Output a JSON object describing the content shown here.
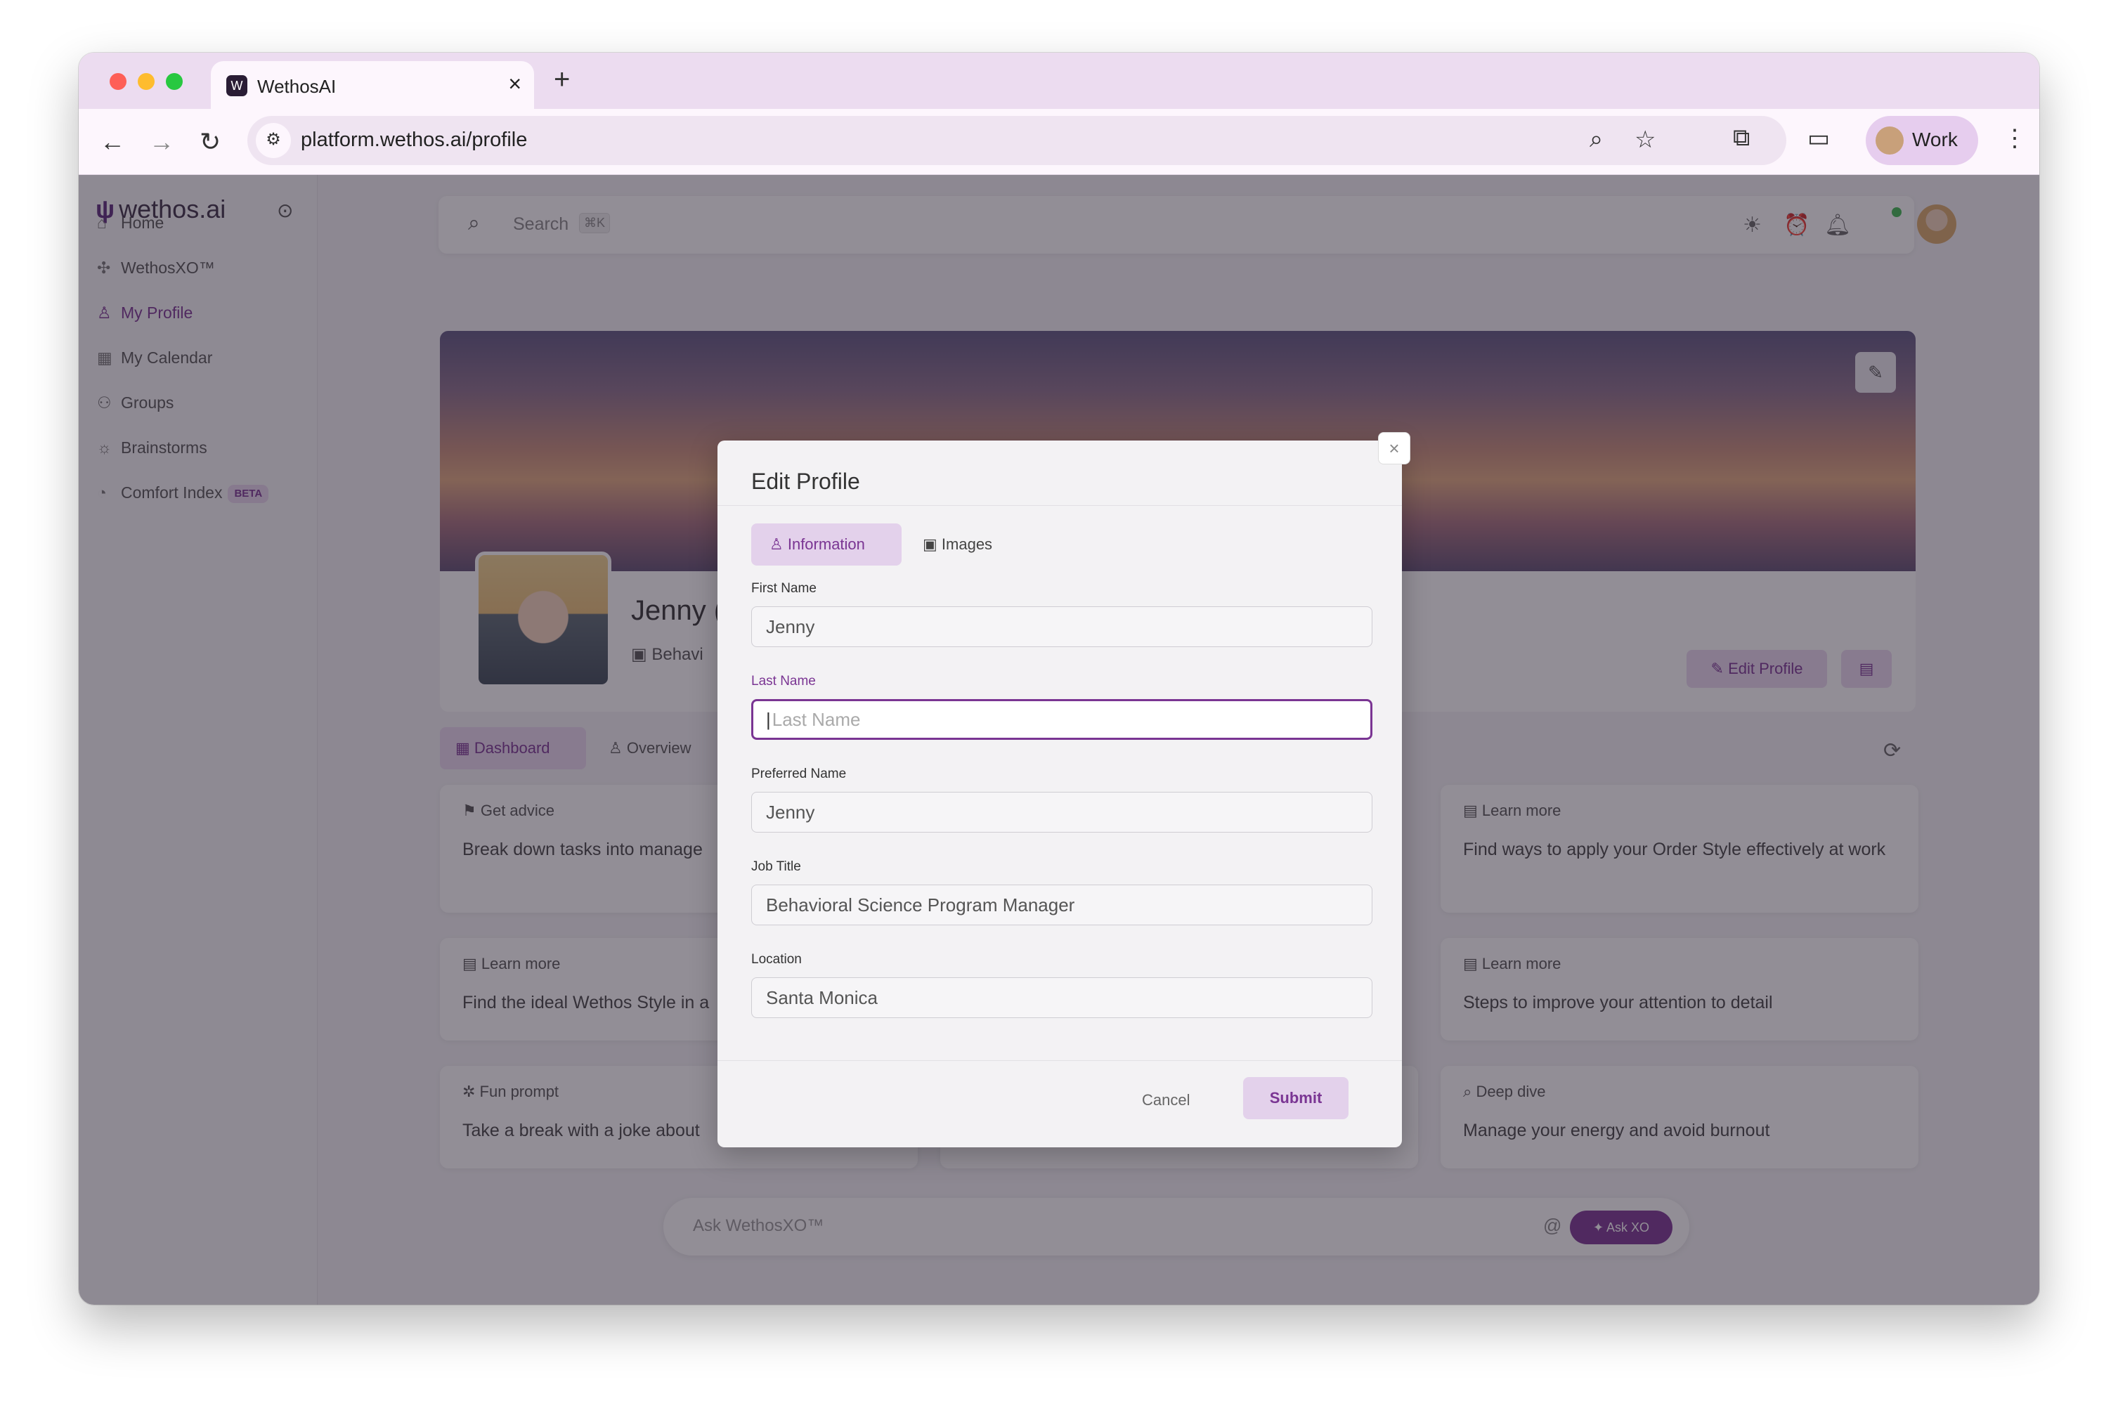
{
  "browser": {
    "tab_title": "WethosAI",
    "tab_favicon": "wethos-logo-icon",
    "url": "platform.wethos.ai/profile",
    "profile_label": "Work"
  },
  "sidebar": {
    "brand": "wethos.ai",
    "items": [
      {
        "label": "Home",
        "icon": "home-icon"
      },
      {
        "label": "WethosXO™",
        "icon": "network-icon"
      },
      {
        "label": "My Profile",
        "icon": "user-icon",
        "active": true
      },
      {
        "label": "My Calendar",
        "icon": "calendar-icon"
      },
      {
        "label": "Groups",
        "icon": "groups-icon"
      },
      {
        "label": "Brainstorms",
        "icon": "lightbulb-icon"
      },
      {
        "label": "Comfort Index",
        "icon": "gauge-icon",
        "badge": "BETA"
      }
    ]
  },
  "header": {
    "search_placeholder": "Search",
    "search_shortcut": "⌘K"
  },
  "profile": {
    "name": "Jenny (",
    "subtitle": "Behavi",
    "edit_label": "Edit Profile"
  },
  "tabs": {
    "dashboard": "Dashboard",
    "overview": "Overview"
  },
  "cards": [
    {
      "header": "Get advice",
      "body": "Break down tasks into manage"
    },
    {
      "header": "Learn more",
      "body": "Find ways to apply your Order Style effectively at work"
    },
    {
      "header": "Learn more",
      "body": "Find the ideal Wethos Style in a"
    },
    {
      "header": "Learn more",
      "body": "Steps to improve your attention to detail"
    },
    {
      "header": "Fun prompt",
      "body": "Take a break with a joke about"
    },
    {
      "header": "Deep dive",
      "body": "Manage your energy and avoid burnout"
    }
  ],
  "ask": {
    "placeholder": "Ask WethosXO™",
    "at": "@",
    "button": "Ask XO"
  },
  "modal": {
    "title": "Edit Profile",
    "tabs": {
      "information": "Information",
      "images": "Images"
    },
    "fields": {
      "first_name": {
        "label": "First Name",
        "value": "Jenny"
      },
      "last_name": {
        "label": "Last Name",
        "placeholder": "Last Name"
      },
      "preferred_name": {
        "label": "Preferred Name",
        "value": "Jenny"
      },
      "job_title": {
        "label": "Job Title",
        "value": "Behavioral Science Program Manager"
      },
      "location": {
        "label": "Location",
        "value": "Santa Monica"
      }
    },
    "cancel": "Cancel",
    "submit": "Submit"
  },
  "colors": {
    "accent": "#7a3593",
    "accent_light": "#e3d1eb"
  }
}
